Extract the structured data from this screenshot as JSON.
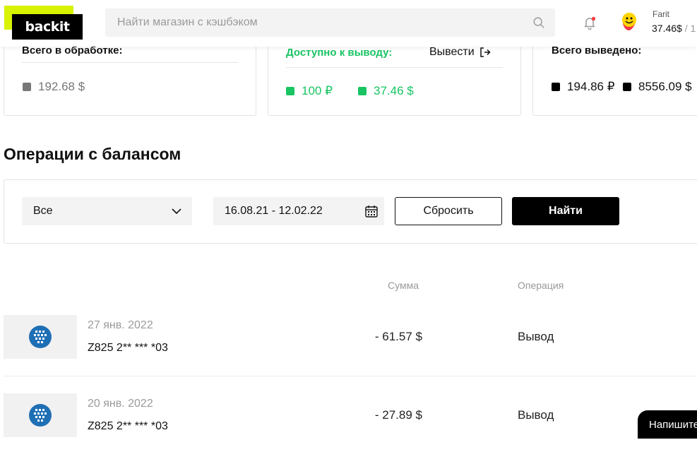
{
  "header": {
    "logo": "backit",
    "search_placeholder": "Найти магазин с кэшбэком",
    "user_name": "Farit",
    "user_balance": "37.46$",
    "user_balance_sep": " / 1"
  },
  "stats": {
    "processing": {
      "title": "Всего в обработке:",
      "value": "192.68 $",
      "color": "#777777"
    },
    "available": {
      "title": "Доступно к выводу:",
      "withdraw_label": "Вывести",
      "values": [
        "100 ₽",
        "37.46 $"
      ],
      "color": "#19c463"
    },
    "withdrawn": {
      "title": "Всего выведено:",
      "values": [
        "194.86 ₽",
        "8556.09 $"
      ],
      "color": "#000000"
    }
  },
  "section_title": "Операции с балансом",
  "filter": {
    "type_selected": "Все",
    "date_range": "16.08.21 - 12.02.22",
    "reset_label": "Сбросить",
    "find_label": "Найти"
  },
  "table": {
    "headers": {
      "amount": "Сумма",
      "operation": "Операция"
    },
    "rows": [
      {
        "icon": "webmoney-icon",
        "date": "27 янв. 2022",
        "wallet": "Z825 2** *** *03",
        "amount": "- 61.57 $",
        "operation": "Вывод"
      },
      {
        "icon": "webmoney-icon",
        "date": "20 янв. 2022",
        "wallet": "Z825 2** *** *03",
        "amount": "- 27.89 $",
        "operation": "Вывод"
      }
    ]
  },
  "chat_label": "Напишите"
}
